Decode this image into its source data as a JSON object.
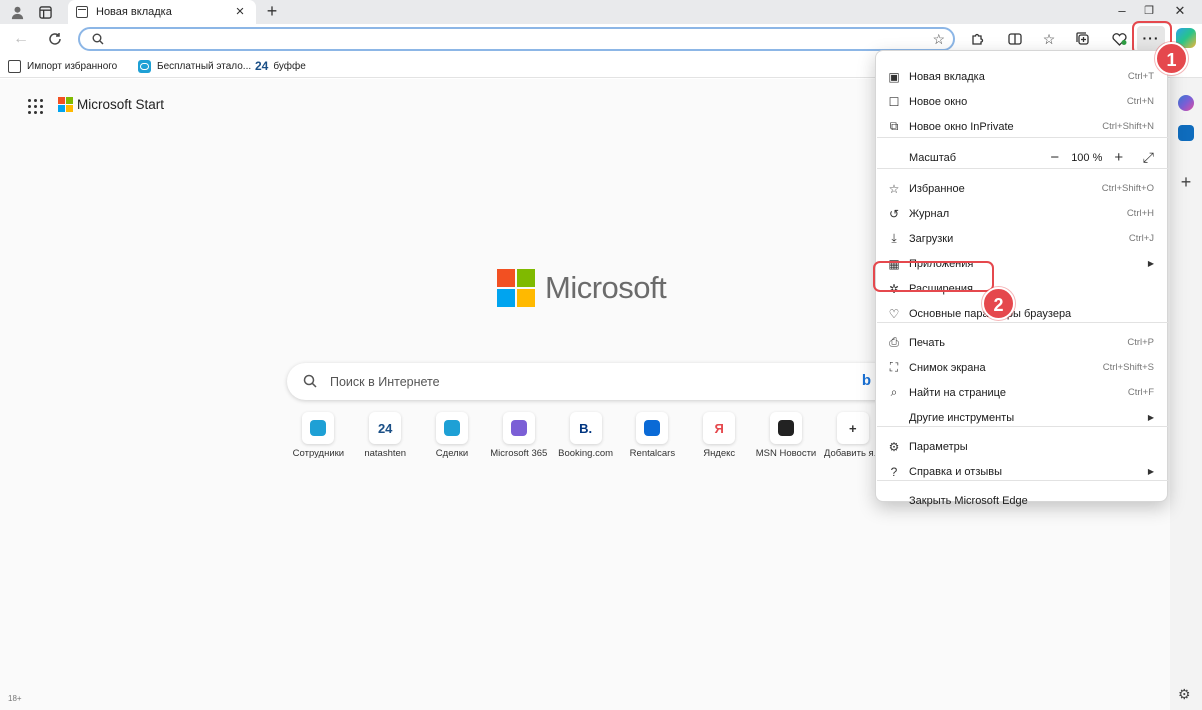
{
  "tab": {
    "title": "Новая вкладка"
  },
  "favorites_bar": {
    "items": [
      "Импорт избранного",
      "Бесплатный этало...",
      "буффе"
    ],
    "item3_icon_text": "24"
  },
  "page": {
    "brand_small": "Microsoft Start",
    "brand_big": "Microsoft",
    "search_placeholder": "Поиск в Интернете",
    "quick_links": [
      {
        "label": "Сотрудники",
        "tile": "",
        "color": "#1ea0d5"
      },
      {
        "label": "natashten",
        "tile": "24",
        "color": "#1a4f86"
      },
      {
        "label": "Сделки",
        "tile": "",
        "color": "#1ea0d5"
      },
      {
        "label": "Microsoft 365",
        "tile": "",
        "color": "#7b5fd6"
      },
      {
        "label": "Booking.com",
        "tile": "B.",
        "color": "#003580"
      },
      {
        "label": "Rentalcars",
        "tile": "",
        "color": "#0a6ad6"
      },
      {
        "label": "Яндекс",
        "tile": "Я",
        "color": "#e5484d"
      },
      {
        "label": "MSN Новости",
        "tile": "",
        "color": "#222222"
      },
      {
        "label": "Добавить я...",
        "tile": "+",
        "color": "#333333"
      }
    ],
    "age_label": "18+"
  },
  "menu": {
    "items": [
      {
        "label": "Новая вкладка",
        "shortcut": "Ctrl+T",
        "icon": "new-tab-icon"
      },
      {
        "label": "Новое окно",
        "shortcut": "Ctrl+N",
        "icon": "new-window-icon"
      },
      {
        "label": "Новое окно InPrivate",
        "shortcut": "Ctrl+Shift+N",
        "icon": "inprivate-icon"
      },
      {
        "label": "Масштаб",
        "shortcut": "",
        "icon": ""
      },
      {
        "label": "Избранное",
        "shortcut": "Ctrl+Shift+O",
        "icon": "favorites-icon"
      },
      {
        "label": "Журнал",
        "shortcut": "Ctrl+H",
        "icon": "history-icon"
      },
      {
        "label": "Загрузки",
        "shortcut": "Ctrl+J",
        "icon": "download-icon"
      },
      {
        "label": "Приложения",
        "shortcut": "",
        "icon": "apps-icon"
      },
      {
        "label": "Расширения",
        "shortcut": "",
        "icon": "extensions-icon"
      },
      {
        "label": "Основные параметры браузера",
        "shortcut": "",
        "icon": "essentials-icon"
      },
      {
        "label": "Печать",
        "shortcut": "Ctrl+P",
        "icon": "print-icon"
      },
      {
        "label": "Снимок экрана",
        "shortcut": "Ctrl+Shift+S",
        "icon": "screenshot-icon"
      },
      {
        "label": "Найти на странице",
        "shortcut": "Ctrl+F",
        "icon": "find-icon"
      },
      {
        "label": "Другие инструменты",
        "shortcut": "",
        "icon": ""
      },
      {
        "label": "Параметры",
        "shortcut": "",
        "icon": "settings-icon"
      },
      {
        "label": "Справка и отзывы",
        "shortcut": "",
        "icon": "help-icon"
      },
      {
        "label": "Закрыть Microsoft Edge",
        "shortcut": "",
        "icon": ""
      }
    ],
    "zoom_value": "100 %"
  },
  "annotations": {
    "step1": "1",
    "step2": "2"
  },
  "colors": {
    "accent_red": "#e5484d",
    "address_focus": "#8cb6e6"
  }
}
